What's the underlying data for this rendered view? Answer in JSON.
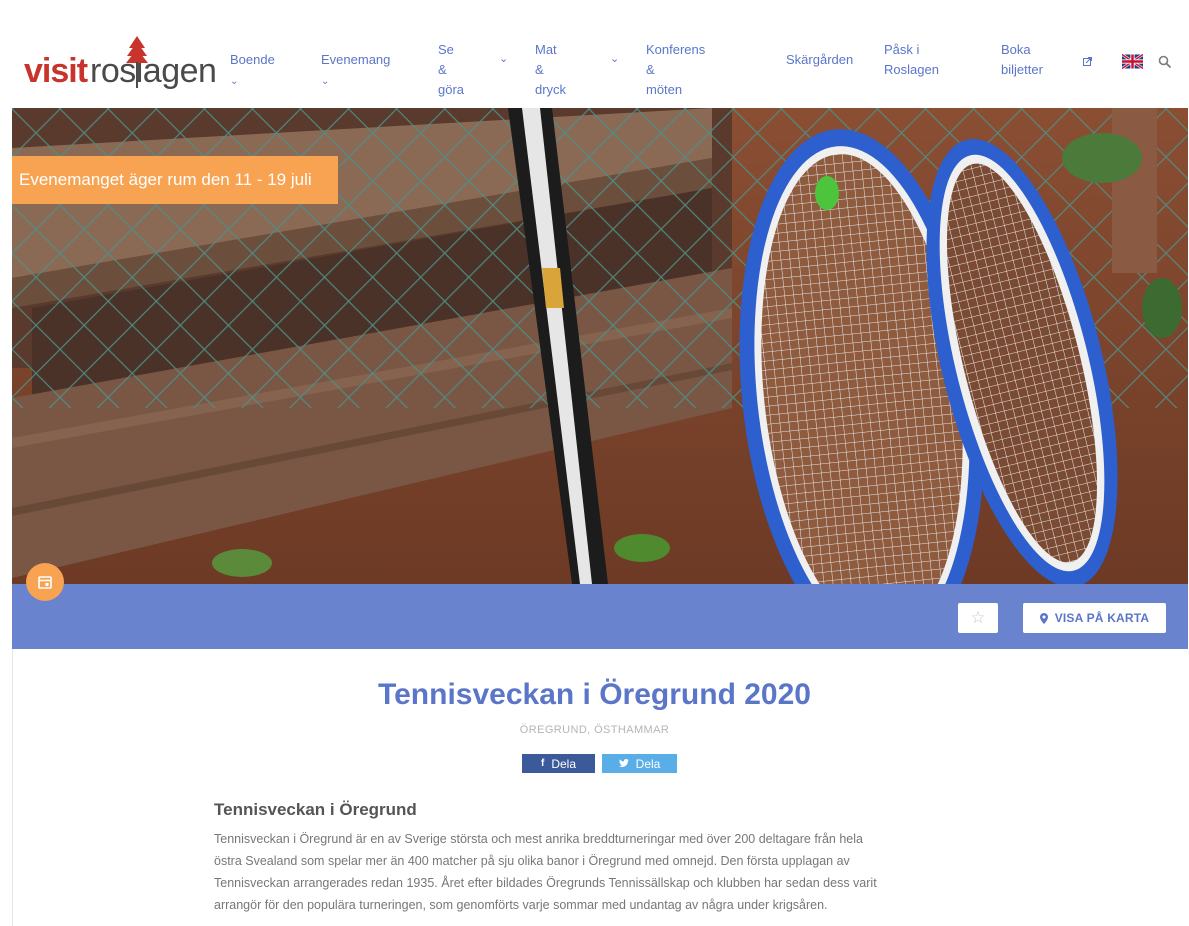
{
  "header": {
    "logo": {
      "visit": "visit",
      "roslagen": "roslagen",
      "alt": "visit roslagen"
    },
    "nav": [
      {
        "label": "Boende",
        "dropdown": true
      },
      {
        "label": "Evenemang",
        "dropdown": true
      },
      {
        "label_line1": "Se &",
        "label_line2": "göra",
        "dropdown": true
      },
      {
        "label_line1": "Mat &",
        "label_line2": "dryck",
        "dropdown": true
      },
      {
        "label_line1": "Konferens &",
        "label_line2": "möten",
        "dropdown": false
      },
      {
        "label": "Skärgården",
        "dropdown": false
      },
      {
        "label_line1": "Påsk i",
        "label_line2": "Roslagen",
        "dropdown": false
      },
      {
        "label_line1": "Boka",
        "label_line2": "biljetter",
        "dropdown": false
      }
    ],
    "icons": [
      "external-link-icon",
      "uk-flag-icon",
      "search-icon"
    ]
  },
  "hero": {
    "banner_text": "Evenemanget äger rum den 11 - 19 juli",
    "image": "tennis-rackets-leaning-against-fence"
  },
  "actions": {
    "calendar_icon": "calendar-icon",
    "favorite_icon": "star-icon",
    "map_button": "VISA PÅ KARTA"
  },
  "event": {
    "title": "Tennisveckan i Öregrund 2020",
    "location": "ÖREGRUND, ÖSTHAMMAR",
    "share_facebook": "Dela",
    "share_twitter": "Dela",
    "article_heading": "Tennisveckan i Öregrund",
    "article_lines": [
      "Tennisveckan i Öregrund är en av Sverige största och mest anrika breddturneringar med över 200 deltagare från hela",
      "östra Svealand som spelar mer än 400 matcher på sju olika banor i Öregrund med omnejd. Den första upplagan av",
      "Tennisveckan arrangerades redan 1935. Året efter bildades Öregrunds Tennissällskap och klubben har sedan dess varit",
      "arrangör för den populära turneringen, som genomförts varje sommar med undantag av några under krigsåren."
    ]
  },
  "colors": {
    "brand_blue": "#5b76c8",
    "bar_blue": "#6a83cf",
    "accent_orange": "#f7a352",
    "logo_red": "#c8342c",
    "facebook": "#3c5a99",
    "twitter": "#5aaee8"
  }
}
